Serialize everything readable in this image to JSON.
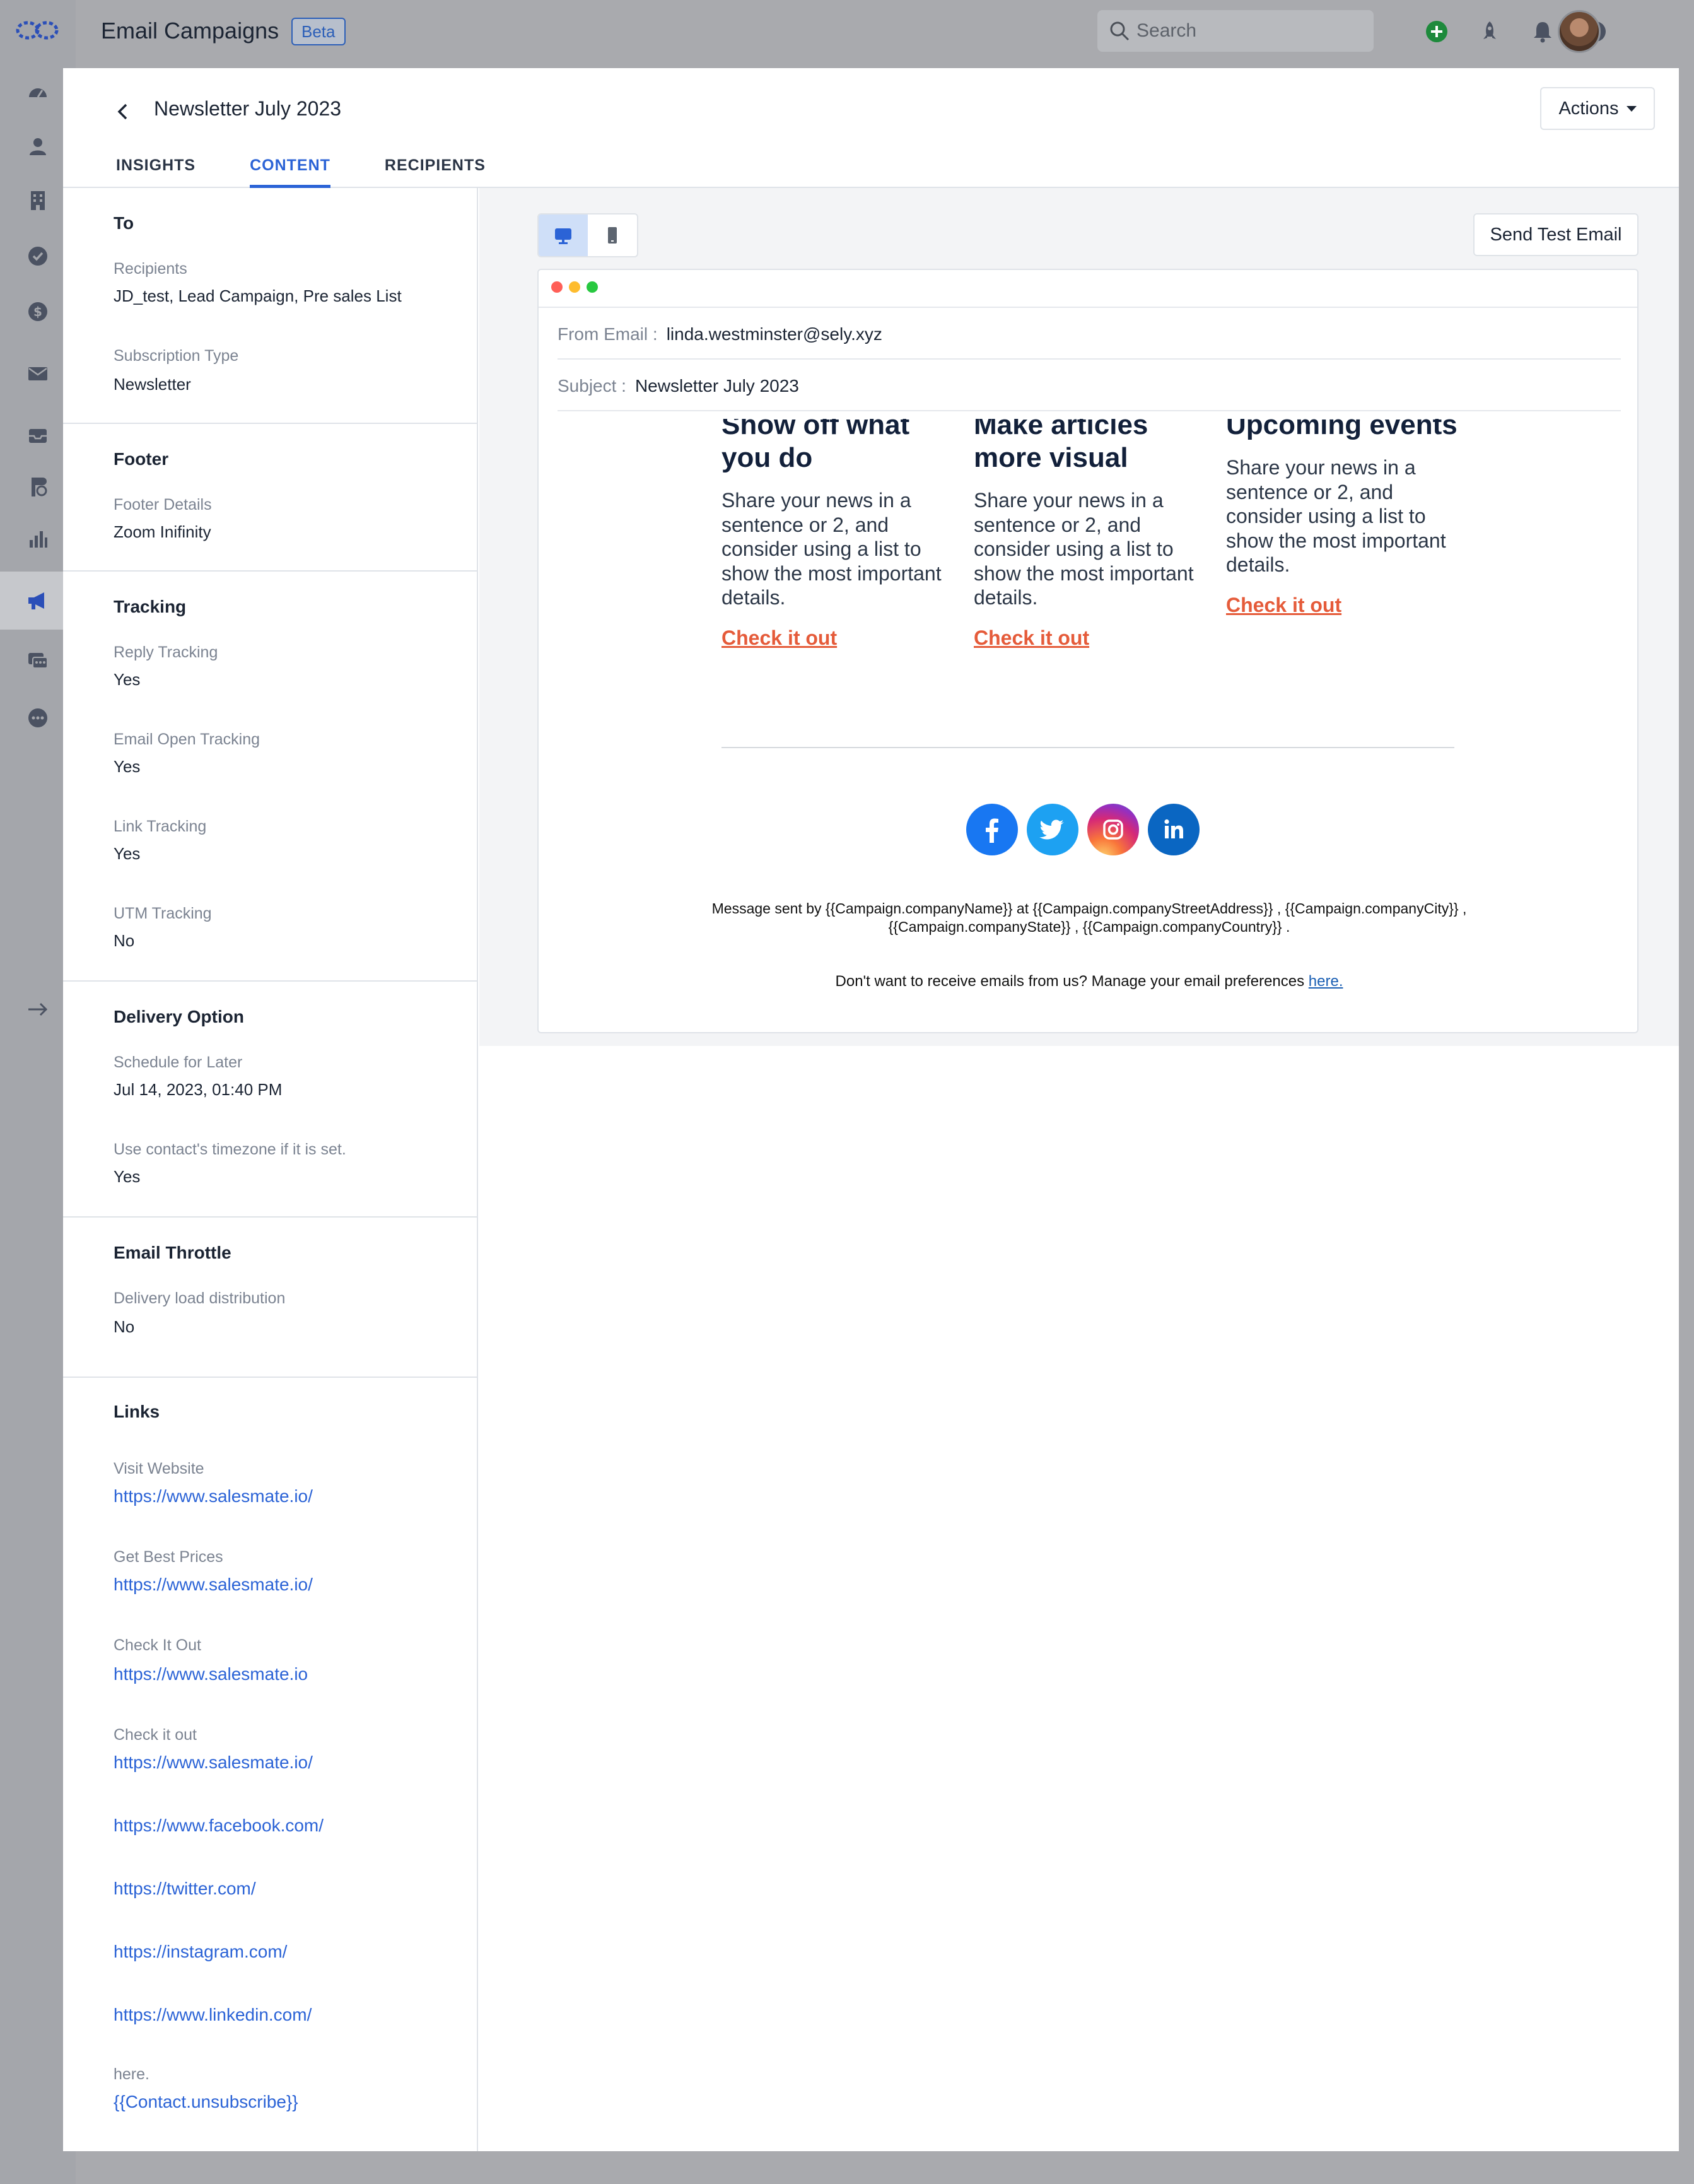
{
  "app": {
    "title": "Email Campaigns",
    "badge": "Beta",
    "search_placeholder": "Search"
  },
  "nav": {
    "icons": [
      "logo-icon",
      "dashboard-icon",
      "contacts-icon",
      "companies-icon",
      "tasks-icon",
      "deals-icon",
      "email-icon",
      "inbox-icon",
      "sequences-icon",
      "reports-icon",
      "campaigns-icon",
      "chat-icon",
      "more-icon",
      "expand-icon"
    ],
    "active": "campaigns-icon"
  },
  "campaign": {
    "title": "Newsletter July 2023",
    "actions_label": "Actions",
    "tabs": [
      {
        "label": "INSIGHTS",
        "active": false
      },
      {
        "label": "CONTENT",
        "active": true
      },
      {
        "label": "RECIPIENTS",
        "active": false
      }
    ]
  },
  "sidebar": {
    "to": {
      "heading": "To",
      "recipients_label": "Recipients",
      "recipients_value": "JD_test, Lead Campaign, Pre sales List",
      "subscription_label": "Subscription Type",
      "subscription_value": "Newsletter"
    },
    "footer": {
      "heading": "Footer",
      "details_label": "Footer Details",
      "details_value": "Zoom Inifinity"
    },
    "tracking": {
      "heading": "Tracking",
      "reply_label": "Reply Tracking",
      "reply_value": "Yes",
      "open_label": "Email Open Tracking",
      "open_value": "Yes",
      "link_label": "Link Tracking",
      "link_value": "Yes",
      "utm_label": "UTM Tracking",
      "utm_value": "No"
    },
    "delivery": {
      "heading": "Delivery Option",
      "schedule_label": "Schedule for Later",
      "schedule_value": "Jul 14, 2023, 01:40 PM",
      "timezone_label": "Use contact's timezone if it is set.",
      "timezone_value": "Yes"
    },
    "throttle": {
      "heading": "Email Throttle",
      "load_label": "Delivery load distribution",
      "load_value": "No"
    },
    "links": {
      "heading": "Links",
      "items": [
        {
          "label": "Visit Website",
          "url": "https://www.salesmate.io/"
        },
        {
          "label": "Get Best Prices",
          "url": "https://www.salesmate.io/"
        },
        {
          "label": "Check It Out",
          "url": "https://www.salesmate.io"
        },
        {
          "label": "Check it out",
          "url": "https://www.salesmate.io/"
        },
        {
          "label": "",
          "url": "https://www.facebook.com/"
        },
        {
          "label": "",
          "url": "https://twitter.com/"
        },
        {
          "label": "",
          "url": "https://instagram.com/"
        },
        {
          "label": "",
          "url": "https://www.linkedin.com/"
        },
        {
          "label": "here.",
          "url": "{{Contact.unsubscribe}}"
        }
      ]
    }
  },
  "preview": {
    "send_test_label": "Send Test Email",
    "view_modes": [
      "desktop-icon",
      "mobile-icon"
    ],
    "active_view": "desktop-icon",
    "from_label": "From Email :",
    "from_value": "linda.westminster@sely.xyz",
    "subject_label": "Subject :",
    "subject_value": "Newsletter July 2023",
    "columns": [
      {
        "heading": "Show off what you do",
        "body": "Share your news in a sentence or 2, and consider using a list to show the most important details.",
        "link": "Check it out"
      },
      {
        "heading": "Make articles more visual",
        "body": "Share your news in a sentence or 2, and consider using a list to show the most important details.",
        "link": "Check it out"
      },
      {
        "heading": "Upcoming events",
        "body": "Share your news in a sentence or 2, and consider using a list to show the most important details.",
        "link": "Check it out"
      }
    ],
    "socials": [
      "facebook-icon",
      "twitter-icon",
      "instagram-icon",
      "linkedin-icon"
    ],
    "footer_message": "Message sent by {{Campaign.companyName}} at {{Campaign.companyStreetAddress}} , {{Campaign.companyCity}} , {{Campaign.companyState}} , {{Campaign.companyCountry}} .",
    "unsubscribe_text": "Don't want to receive emails from us? Manage your email preferences",
    "unsubscribe_link": "here."
  },
  "colors": {
    "accent": "#2b63d6",
    "link_orange": "#e55b3a",
    "facebook": "#1877f2",
    "twitter": "#1da1f2",
    "linkedin": "#0a66c2",
    "dot_red": "#ff5f57",
    "dot_yellow": "#febc2e",
    "dot_green": "#28c840"
  }
}
